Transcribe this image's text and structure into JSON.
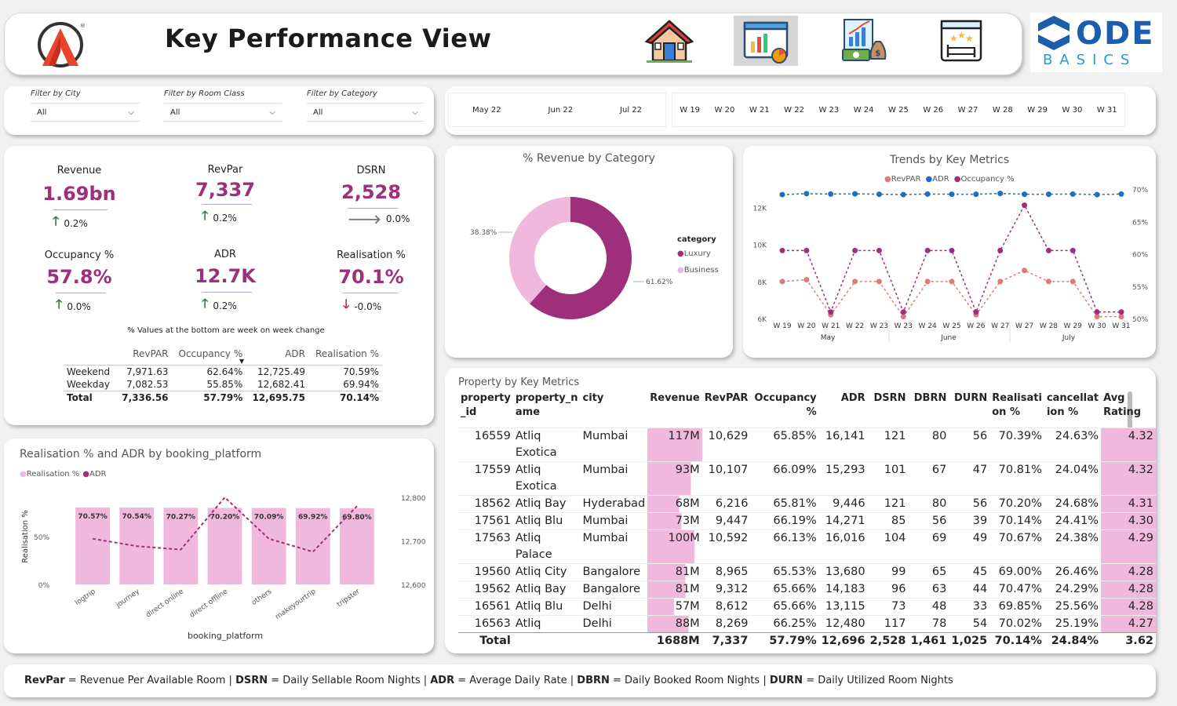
{
  "header": {
    "title": "Key Performance View",
    "brand_right": {
      "word": "ODE",
      "sub": "BASICS"
    }
  },
  "filters": [
    {
      "label": "Filter by City",
      "value": "All"
    },
    {
      "label": "Filter by Room Class",
      "value": "All"
    },
    {
      "label": "Filter by Category",
      "value": "All"
    }
  ],
  "months": [
    "May 22",
    "Jun 22",
    "Jul 22"
  ],
  "weeks": [
    "W 19",
    "W 20",
    "W 21",
    "W 22",
    "W 23",
    "W 24",
    "W 25",
    "W 26",
    "W 27",
    "W 28",
    "W 29",
    "W 30",
    "W 31"
  ],
  "kpis": [
    {
      "label": "Revenue",
      "value": "1.69bn",
      "change": "0.2%",
      "dir": "up"
    },
    {
      "label": "RevPar",
      "value": "7,337",
      "change": "0.2%",
      "dir": "up"
    },
    {
      "label": "DSRN",
      "value": "2,528",
      "change": "0.0%",
      "dir": "flat"
    },
    {
      "label": "Occupancy %",
      "value": "57.8%",
      "change": "0.0%",
      "dir": "up"
    },
    {
      "label": "ADR",
      "value": "12.7K",
      "change": "0.2%",
      "dir": "up"
    },
    {
      "label": "Realisation %",
      "value": "70.1%",
      "change": "-0.0%",
      "dir": "down"
    }
  ],
  "kpi_note": "% Values at the bottom are week on week change",
  "daytype_table": {
    "headers": [
      "",
      "RevPAR",
      "Occupancy %",
      "ADR",
      "Realisation %"
    ],
    "rows": [
      [
        "Weekend",
        "7,971.63",
        "62.64%",
        "12,725.49",
        "70.59%"
      ],
      [
        "Weekday",
        "7,082.53",
        "55.85%",
        "12,682.41",
        "69.94%"
      ]
    ],
    "total": [
      "Total",
      "7,336.56",
      "57.79%",
      "12,695.75",
      "70.14%"
    ]
  },
  "donut": {
    "title": "% Revenue by Category",
    "legend_title": "category",
    "labels": [
      "38.38%",
      "61.62%"
    ]
  },
  "trends": {
    "title": "Trends by Key Metrics",
    "legend": [
      "RevPAR",
      "ADR",
      "Occupancy %"
    ],
    "left_ticks": [
      "12K",
      "10K",
      "8K",
      "6K"
    ],
    "right_ticks": [
      "70%",
      "65%",
      "60%",
      "55%",
      "50%"
    ],
    "month_labels": [
      "May",
      "June",
      "July"
    ],
    "x_ticks": [
      "W 19",
      "W 20",
      "W 21",
      "W 22",
      "W 23",
      "W 23",
      "W 24",
      "W 25",
      "W 26",
      "W 27",
      "W 27",
      "W 28",
      "W 29",
      "W 30",
      "W 31"
    ]
  },
  "platform_chart": {
    "title": "Realisation % and ADR by booking_platform",
    "legend": [
      "Realisation %",
      "ADR"
    ],
    "ylabel": "Realisation %",
    "xlabel": "booking_platform",
    "left_ticks": [
      "50%",
      "0%"
    ],
    "right_ticks": [
      "12,800",
      "12,700",
      "12,600"
    ]
  },
  "property_table": {
    "title": "Property by Key Metrics",
    "headers": [
      "property\n_id",
      "property_n\name",
      "city",
      "Revenue",
      "RevPAR",
      "Occupancy %",
      "ADR",
      "DSRN",
      "DBRN",
      "DURN",
      "Realisati\non %",
      "cancellat\nion %",
      "Avg Rating"
    ],
    "rows": [
      [
        "16559",
        "Atliq\nExotica",
        "Mumbai",
        "117M",
        "10,629",
        "65.85%",
        "16,141",
        "121",
        "80",
        "56",
        "70.39%",
        "24.63%",
        "4.32"
      ],
      [
        "17559",
        "Atliq\nExotica",
        "Mumbai",
        "93M",
        "10,107",
        "66.09%",
        "15,293",
        "101",
        "67",
        "47",
        "70.81%",
        "24.04%",
        "4.32"
      ],
      [
        "18562",
        "Atliq Bay",
        "Hyderabad",
        "68M",
        "6,216",
        "65.81%",
        "9,446",
        "121",
        "80",
        "56",
        "70.20%",
        "24.68%",
        "4.31"
      ],
      [
        "17561",
        "Atliq Blu",
        "Mumbai",
        "73M",
        "9,447",
        "66.19%",
        "14,271",
        "85",
        "56",
        "39",
        "70.14%",
        "24.41%",
        "4.30"
      ],
      [
        "17563",
        "Atliq\nPalace",
        "Mumbai",
        "100M",
        "10,592",
        "66.13%",
        "16,016",
        "104",
        "69",
        "49",
        "70.67%",
        "24.38%",
        "4.29"
      ],
      [
        "19560",
        "Atliq City",
        "Bangalore",
        "81M",
        "8,965",
        "65.53%",
        "13,680",
        "99",
        "65",
        "45",
        "69.00%",
        "26.46%",
        "4.28"
      ],
      [
        "19562",
        "Atliq Bay",
        "Bangalore",
        "81M",
        "9,312",
        "65.66%",
        "14,183",
        "96",
        "63",
        "44",
        "70.47%",
        "24.29%",
        "4.28"
      ],
      [
        "16561",
        "Atliq Blu",
        "Delhi",
        "57M",
        "8,612",
        "65.66%",
        "13,115",
        "73",
        "48",
        "33",
        "69.85%",
        "25.56%",
        "4.28"
      ],
      [
        "16563",
        "Atliq",
        "Delhi",
        "88M",
        "8,269",
        "66.25%",
        "12,480",
        "117",
        "78",
        "54",
        "70.02%",
        "25.19%",
        "4.27"
      ]
    ],
    "total": [
      "Total",
      "",
      "",
      "1688M",
      "7,337",
      "57.79%",
      "12,696",
      "2,528",
      "1,461",
      "1,025",
      "70.14%",
      "24.84%",
      "3.62"
    ]
  },
  "footer": {
    "items": [
      {
        "abbr": "RevPar",
        "def": " = Revenue Per Available Room | "
      },
      {
        "abbr": "DSRN",
        "def": " = Daily Sellable Room Nights | "
      },
      {
        "abbr": "ADR",
        "def": " = Average Daily Rate | "
      },
      {
        "abbr": "DBRN",
        "def": " = Daily Booked Room Nights | "
      },
      {
        "abbr": "DURN",
        "def": " = Daily Utilized Room Nights"
      }
    ]
  },
  "colors": {
    "accent": "#9e2f7a",
    "pink": "#f0b8dd",
    "blue": "#1f6fbf",
    "salmon": "#e07a7a"
  },
  "chart_data": [
    {
      "type": "pie",
      "title": "% Revenue by Category",
      "categories": [
        "Luxury",
        "Business"
      ],
      "values": [
        61.62,
        38.38
      ]
    },
    {
      "type": "line",
      "title": "Trends by Key Metrics",
      "x": [
        "W 19",
        "W 20",
        "W 21",
        "W 22",
        "W 23",
        "W 23",
        "W 24",
        "W 25",
        "W 26",
        "W 27",
        "W 27",
        "W 28",
        "W 29",
        "W 30",
        "W 31"
      ],
      "series": [
        {
          "name": "RevPAR",
          "axis": "left",
          "values": [
            8000,
            8100,
            6200,
            8000,
            8000,
            6100,
            8000,
            8000,
            6200,
            8000,
            8600,
            8000,
            8000,
            6100,
            6100
          ]
        },
        {
          "name": "ADR",
          "axis": "left",
          "values": [
            12700,
            12750,
            12730,
            12740,
            12720,
            12700,
            12730,
            12720,
            12720,
            12760,
            12720,
            12720,
            12730,
            12700,
            12730
          ]
        },
        {
          "name": "Occupancy %",
          "axis": "right",
          "values": [
            60.5,
            60.5,
            51,
            60.5,
            60.5,
            51,
            60.5,
            60.5,
            51,
            60.5,
            67.5,
            60.5,
            60.5,
            51,
            51
          ]
        }
      ],
      "ylim_left": [
        6000,
        13000
      ],
      "ylim_right": [
        50,
        70
      ]
    },
    {
      "type": "bar",
      "title": "Realisation % and ADR by booking_platform",
      "categories": [
        "logtrip",
        "journey",
        "direct online",
        "direct offline",
        "others",
        "makeyourtrip",
        "tripster"
      ],
      "series": [
        {
          "name": "Realisation %",
          "axis": "left",
          "values": [
            70.57,
            70.54,
            70.27,
            70.2,
            70.09,
            69.92,
            69.8
          ]
        },
        {
          "name": "ADR",
          "axis": "right",
          "values": [
            12705,
            12688,
            12680,
            12800,
            12705,
            12675,
            12780
          ]
        }
      ],
      "ylim_left": [
        0,
        100
      ],
      "ylim_right": [
        12600,
        12820
      ]
    }
  ]
}
